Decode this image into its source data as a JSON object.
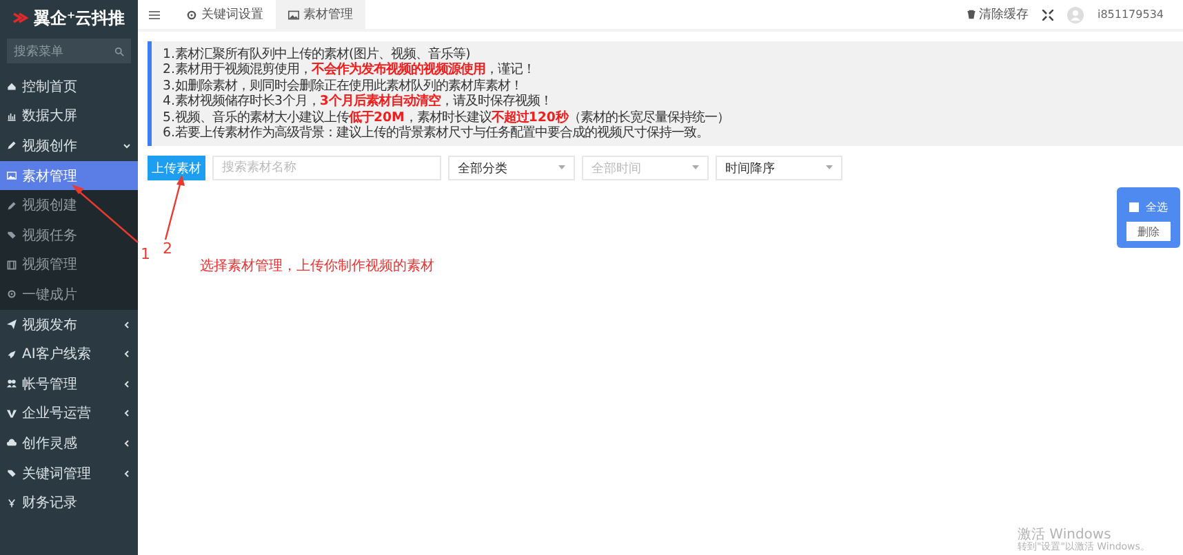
{
  "sidebar": {
    "logo": "翼企⁺云抖推",
    "search": {
      "placeholder": "搜索菜单"
    },
    "items": [
      {
        "label": "控制首页"
      },
      {
        "label": "数据大屏"
      },
      {
        "label": "视频创作",
        "expanded": true,
        "children": [
          {
            "label": "素材管理",
            "selected": true
          },
          {
            "label": "视频创建",
            "selected": false
          },
          {
            "label": "视频任务",
            "selected": false
          },
          {
            "label": "视频管理",
            "selected": false
          },
          {
            "label": "一键成片",
            "selected": false
          }
        ]
      },
      {
        "label": "视频发布",
        "expanded": false
      },
      {
        "label": "AI客户线索",
        "expanded": false
      },
      {
        "label": "帐号管理",
        "expanded": false
      },
      {
        "label": "企业号运营",
        "expanded": false
      },
      {
        "label": "创作灵感",
        "expanded": false
      },
      {
        "label": "关键词管理",
        "expanded": false
      },
      {
        "label": "财务记录"
      }
    ]
  },
  "header": {
    "tabs": [
      {
        "label": "关键词设置",
        "selected": false
      },
      {
        "label": "素材管理",
        "selected": true
      }
    ],
    "clear_cache": "清除缓存",
    "username": "i851179534"
  },
  "notice": [
    "1.素材汇聚所有队列中上传的素材(图片、视频、音乐等)",
    "2.素材用于视频混剪使用，**不会作为发布视频的视频源使用**，谨记！",
    "3.如删除素材，则同时会删除正在使用此素材队列的素材库素材！",
    "4.素材视频储存时长3个月，**3个月后素材自动清空**，请及时保存视频！",
    "5.视频、音乐的素材大小建议上传**低于20M**，素材时长建议**不超过120秒**（素材的长宽尽量保持统一）",
    "6.若要上传素材作为高级背景：建议上传的背景素材尺寸与任务配置中要合成的视频尺寸保持一致。"
  ],
  "toolbar": {
    "upload_button": "上传素材",
    "search": {
      "placeholder": "搜索素材名称"
    },
    "filters": [
      {
        "value": "全部分类"
      },
      {
        "placeholder": "全部时间"
      },
      {
        "value": "时间降序"
      }
    ]
  },
  "bulk_panel": {
    "select_all": {
      "label": "全选",
      "checked": false
    },
    "delete_button": "删除"
  },
  "annotations": {
    "labels": [
      "1",
      "2"
    ],
    "caption": "选择素材管理，上传你制作视频的素材"
  },
  "activation": {
    "title": "激活 Windows",
    "hint": "转到\"设置\"以激活 Windows。"
  }
}
